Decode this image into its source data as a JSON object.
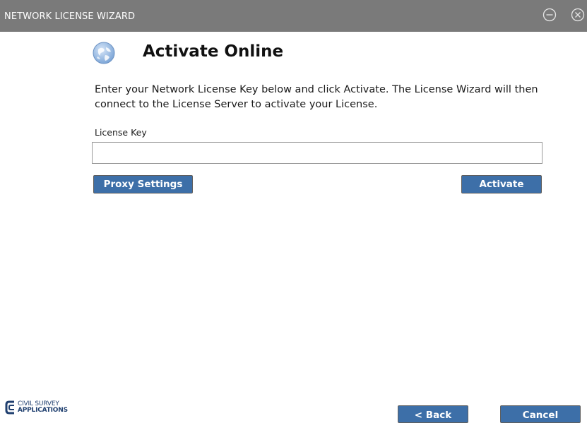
{
  "window": {
    "title": "NETWORK LICENSE WIZARD",
    "minimize_icon": "minimize-circle-icon",
    "close_icon": "close-circle-icon"
  },
  "page": {
    "heading": "Activate Online",
    "heading_icon": "globe-icon",
    "instructions": "Enter your Network License Key below and click Activate. The License Wizard will then connect to the License Server to activate your License."
  },
  "license_key": {
    "label": "License Key",
    "value": "",
    "placeholder": ""
  },
  "buttons": {
    "proxy_settings": "Proxy Settings",
    "activate": "Activate",
    "back": "< Back",
    "cancel": "Cancel"
  },
  "logo": {
    "line1": "CIVIL SURVEY",
    "line2": "APPLICATIONS"
  },
  "colors": {
    "titlebar": "#7a7a7a",
    "button": "#3d6fa8",
    "logo": "#1f3f6f"
  }
}
